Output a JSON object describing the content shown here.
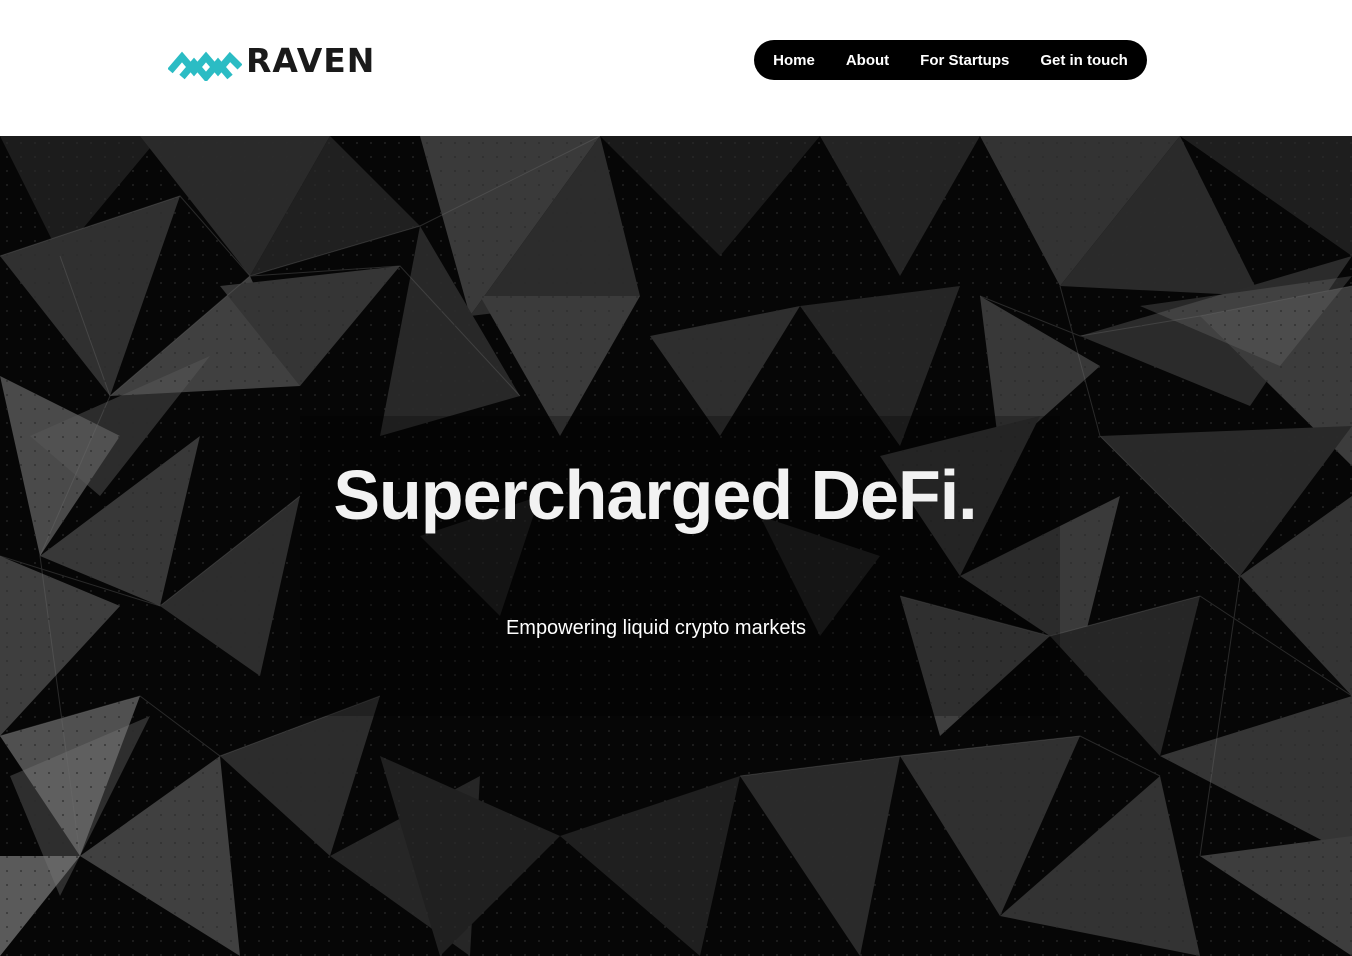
{
  "brand": {
    "name": "RAVEN",
    "accent_color": "#2bbcc4",
    "icon": "raven-logo-mark"
  },
  "nav": {
    "items": [
      {
        "label": "Home"
      },
      {
        "label": "About"
      },
      {
        "label": "For Startups"
      },
      {
        "label": "Get in touch"
      }
    ]
  },
  "hero": {
    "title": "Supercharged DeFi.",
    "subtitle": "Empowering liquid crypto markets",
    "background": "dark low-poly geometric pattern"
  }
}
